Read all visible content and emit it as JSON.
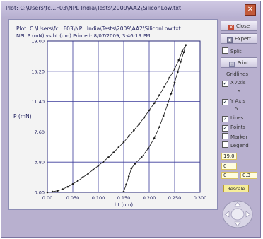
{
  "window": {
    "title": "Plot: C:\\Users\\fc...F03\\NPL India\\Tests\\2009\\AA2\\SiliconLow.txt",
    "close_glyph": "✕"
  },
  "plot": {
    "line1": "Plot:  C:\\Users\\fc...F03\\NPL India\\Tests\\2009\\AA2\\SiliconLow.txt",
    "line2": "NPL P (mN) vs ht (um)  Printed: 8/07/2009, 3:46:19 PM"
  },
  "side": {
    "close_label": "Close",
    "expert_label": "Expert",
    "split_label": "Split",
    "print_label": "Print",
    "gridlines_label": "Gridlines",
    "x_axis_label": "X Axis",
    "x_axis_value": "5",
    "y_axis_label": "Y Axis",
    "y_axis_value": "5",
    "lines_label": "Lines",
    "points_label": "Points",
    "marker_label": "Marker",
    "legend_label": "Legend",
    "ymax_value": "19.0",
    "ymin_value": "0",
    "xmin_value": "0",
    "xmax_value": "0.3",
    "rescale_label": "Rescale"
  },
  "chart_data": {
    "type": "line",
    "title": "",
    "xlabel": "ht (um)",
    "ylabel": "P (mN)",
    "xlim": [
      0,
      0.3
    ],
    "ylim": [
      0,
      19.0
    ],
    "x_ticks": [
      "0.00",
      "0.050",
      "0.100",
      "0.150",
      "0.200",
      "0.250",
      "0.300"
    ],
    "y_ticks": [
      "0.00",
      "3.80",
      "7.60",
      "11.40",
      "15.20",
      "19.00"
    ],
    "grid": true,
    "series": [
      {
        "color": "#1a1a1a",
        "points": [
          [
            0.0,
            0.0
          ],
          [
            0.01,
            0.08
          ],
          [
            0.02,
            0.2
          ],
          [
            0.03,
            0.4
          ],
          [
            0.04,
            0.7
          ],
          [
            0.05,
            1.05
          ],
          [
            0.06,
            1.45
          ],
          [
            0.07,
            1.9
          ],
          [
            0.08,
            2.35
          ],
          [
            0.09,
            2.85
          ],
          [
            0.1,
            3.35
          ],
          [
            0.11,
            3.85
          ],
          [
            0.12,
            4.4
          ],
          [
            0.13,
            5.0
          ],
          [
            0.14,
            5.65
          ],
          [
            0.15,
            6.3
          ],
          [
            0.16,
            7.05
          ],
          [
            0.17,
            7.8
          ],
          [
            0.18,
            8.55
          ],
          [
            0.19,
            9.4
          ],
          [
            0.2,
            10.3
          ],
          [
            0.21,
            11.2
          ],
          [
            0.22,
            12.2
          ],
          [
            0.23,
            13.3
          ],
          [
            0.24,
            14.4
          ],
          [
            0.25,
            15.5
          ],
          [
            0.258,
            16.6
          ],
          [
            0.265,
            17.7
          ],
          [
            0.272,
            18.5
          ],
          [
            0.268,
            17.6
          ],
          [
            0.262,
            16.4
          ],
          [
            0.256,
            15.1
          ],
          [
            0.25,
            13.8
          ],
          [
            0.243,
            12.4
          ],
          [
            0.236,
            11.0
          ],
          [
            0.228,
            9.6
          ],
          [
            0.22,
            8.2
          ],
          [
            0.21,
            6.8
          ],
          [
            0.198,
            5.5
          ],
          [
            0.185,
            4.4
          ],
          [
            0.172,
            3.6
          ],
          [
            0.165,
            3.0
          ],
          [
            0.16,
            2.0
          ],
          [
            0.155,
            1.0
          ],
          [
            0.15,
            0.1
          ]
        ]
      }
    ]
  }
}
